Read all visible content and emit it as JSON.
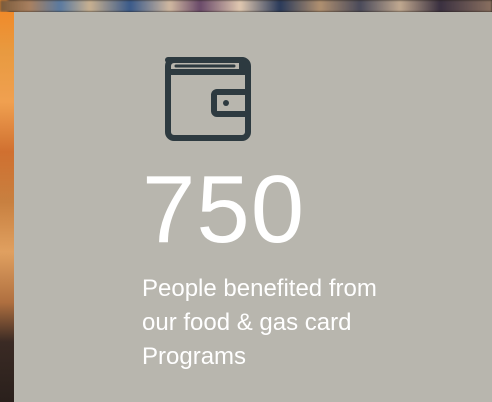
{
  "stat": {
    "icon": "wallet-icon",
    "number": "750",
    "description_lines": [
      "People benefited from",
      "our food & gas card",
      "Programs"
    ]
  },
  "colors": {
    "card_background": "#b8b6ae",
    "icon_color": "#2d3a40",
    "text_color": "#ffffff"
  }
}
